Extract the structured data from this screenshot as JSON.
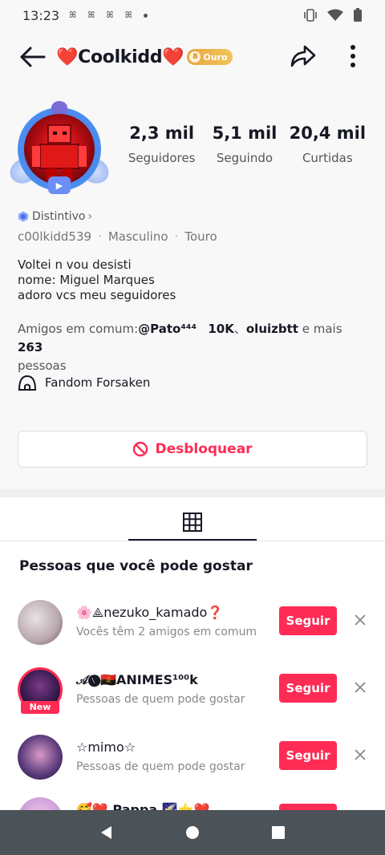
{
  "status_bar": {
    "time": "13:23",
    "notif_glyph": "ꕤ"
  },
  "header": {
    "title": "❤️Coolkidd❤️",
    "badge_label": "Ouro",
    "badge_coin": "8"
  },
  "stats": [
    {
      "value": "2,3 mil",
      "label": "Seguidores"
    },
    {
      "value": "5,1 mil",
      "label": "Seguindo"
    },
    {
      "value": "20,4 mil",
      "label": "Curtidas"
    }
  ],
  "profile": {
    "distintivo": "Distintivo",
    "username": "c00lkidd539",
    "gender": "Masculino",
    "sign": "Touro",
    "separator": "·",
    "bio": [
      "Voltei n vou desisti",
      "nome: Miguel Marques",
      "adoro vcs meu seguidores"
    ],
    "friends_prefix": "Amigos em comum:",
    "friend1": "@Pato⁴⁴⁴",
    "friend2": "10K",
    "friend_sep": "、",
    "friend3": "oluizbtt",
    "friends_more": " e mais ",
    "friends_count": "263",
    "friends_suffix": "pessoas",
    "fandom": "Fandom Forsaken",
    "unblock_label": "Desbloquear"
  },
  "suggestions": {
    "title": "Pessoas que você pode gostar",
    "follow_label": "Seguir",
    "new_label": "New",
    "items": [
      {
        "name": "🌸⟁nezuko_kamado❓",
        "sub": "Vocês têm 2 amigos em comum"
      },
      {
        "name": "𝒜🅥🇦🇴ANIMES¹⁰⁰k",
        "sub": "Pessoas de quem pode gostar"
      },
      {
        "name": "☆mimo☆",
        "sub": "Pessoas de quem pode gostar"
      },
      {
        "name": "🥰❤️ Pappa 🌠⭐❤️",
        "sub": ""
      }
    ]
  },
  "colors": {
    "accent": "#fe2c55",
    "gold": "#e6a640",
    "nav": "#4b5258"
  }
}
